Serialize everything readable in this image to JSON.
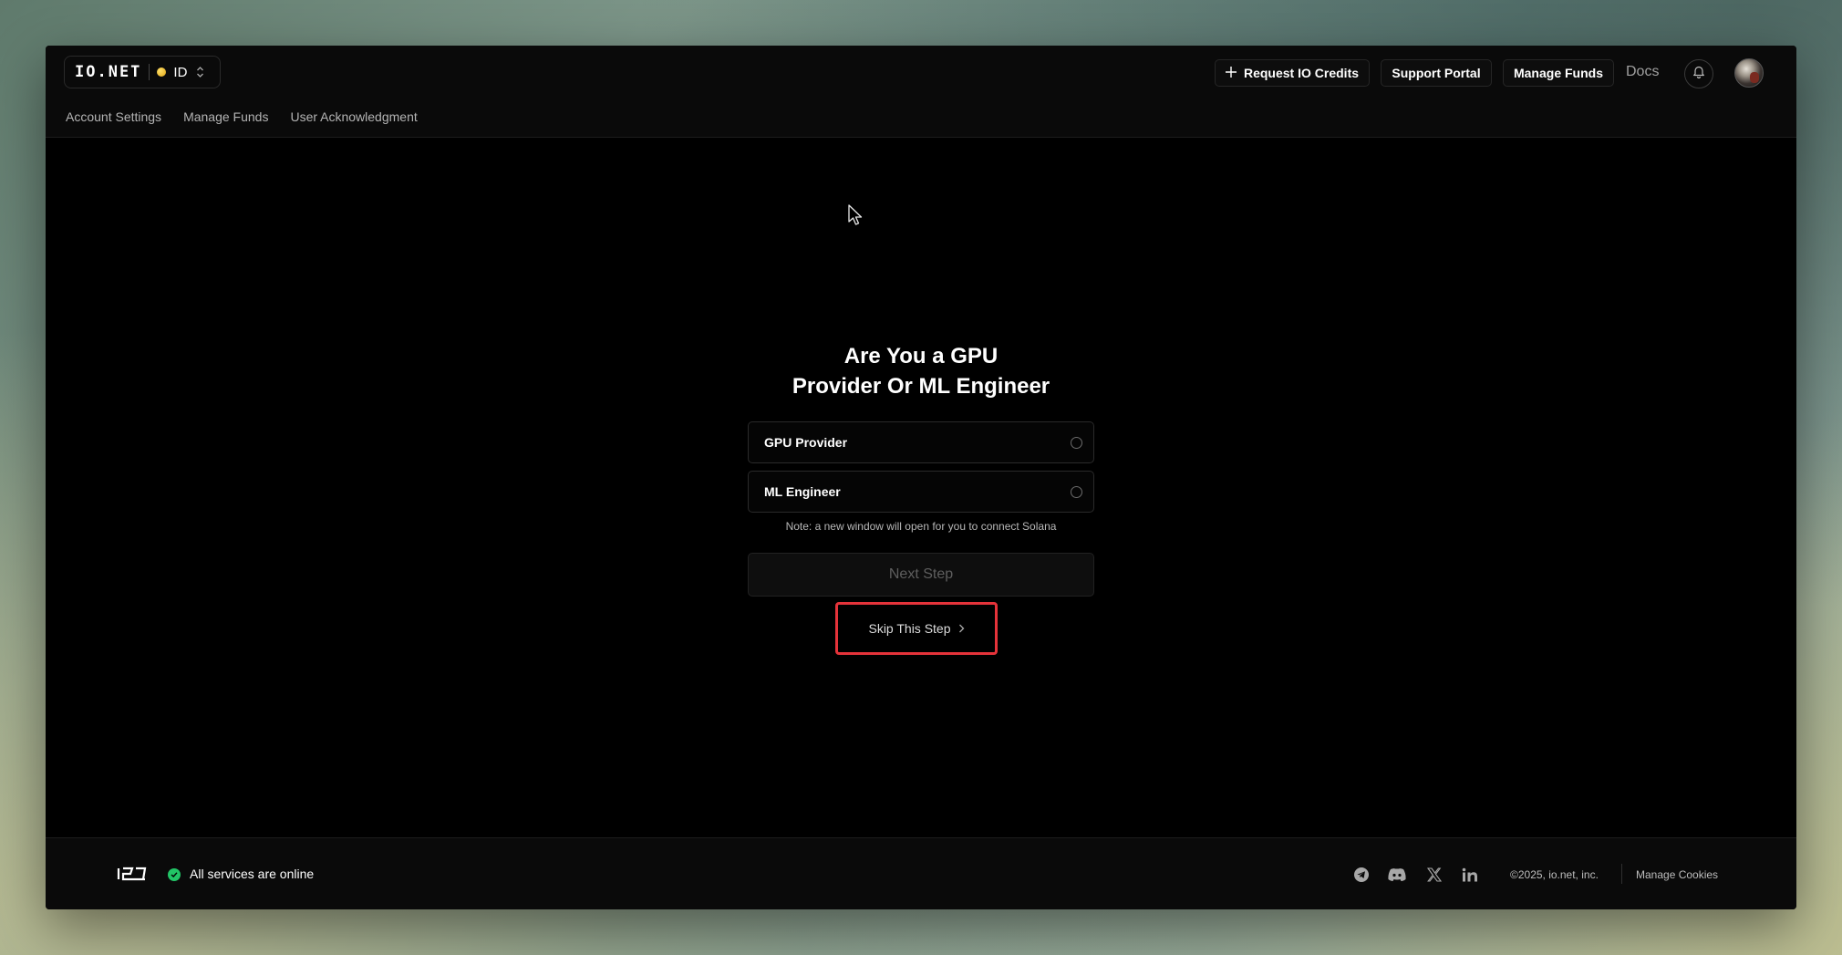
{
  "header": {
    "brand": "IO.NET",
    "account_id": "ID",
    "buttons": {
      "request_credits": "Request IO Credits",
      "support_portal": "Support Portal",
      "manage_funds": "Manage Funds",
      "docs": "Docs"
    },
    "subnav": [
      "Account Settings",
      "Manage Funds",
      "User Acknowledgment"
    ]
  },
  "main": {
    "title_line1": "Are You a GPU",
    "title_line2": "Provider Or ML Engineer",
    "options": [
      "GPU Provider",
      "ML Engineer"
    ],
    "note": "Note: a new window will open for you to connect Solana",
    "next_button": "Next Step",
    "skip_button": "Skip This Step"
  },
  "footer": {
    "status": "All services are online",
    "copyright": "©2025, io.net, inc.",
    "manage_cookies": "Manage Cookies"
  },
  "colors": {
    "accent_red": "#e5333a",
    "status_green": "#22c466",
    "status_yellow": "#e0a514"
  }
}
